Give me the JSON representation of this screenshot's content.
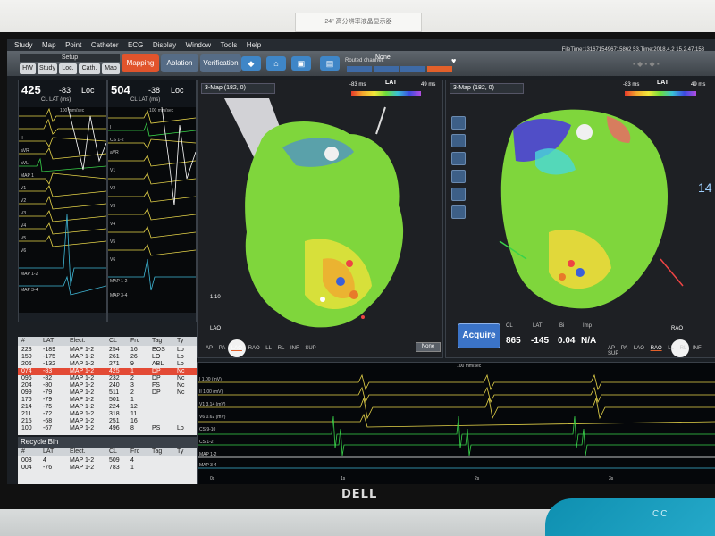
{
  "monitor_label": "24\" 高分辨率液晶显示器",
  "brand": "DELL",
  "cloth_text": "CC",
  "menu": [
    "Study",
    "Map",
    "Point",
    "Catheter",
    "ECG",
    "Display",
    "Window",
    "Tools",
    "Help"
  ],
  "file_time": "FileTime:1316715496715862 53.Time:2018.4.2 15.2.47.158",
  "toolbar": {
    "setup": "Setup",
    "tabs": [
      "HW",
      "Study",
      "Loc.",
      "Cath.",
      "Map"
    ],
    "modes": [
      "Mapping",
      "Ablation",
      "Verification"
    ],
    "routed_label": "Routed channel:",
    "routed_value": "None"
  },
  "ecg_panels": [
    {
      "cl": "425",
      "lat": "-83",
      "loc": "Loc",
      "sub": "CL  LAT (ms)",
      "speed": "100 mm/sec",
      "leads": [
        "I",
        "II",
        "aVR",
        "aVL",
        "MAP 1",
        "V1",
        "V2",
        "V3",
        "V4",
        "V5",
        "V6",
        "MAP 1-2",
        "MAP 3-4"
      ]
    },
    {
      "cl": "504",
      "lat": "-38",
      "loc": "Loc",
      "sub": "CL  LAT (ms)",
      "speed": "100 mm/sec",
      "leads": [
        "I",
        "CS 1-2",
        "aVR",
        "V1",
        "V2",
        "V3",
        "V4",
        "V5",
        "V6",
        "MAP 1-2",
        "MAP 3-4"
      ]
    }
  ],
  "maps": [
    {
      "selector": "3-Map (182, 0)",
      "cmin": "-83 ms",
      "clabel": "LAT",
      "cmax": "49 ms",
      "view": "LAO",
      "scale": "1.10",
      "none": "None"
    },
    {
      "selector": "3-Map (182, 0)",
      "cmin": "-83 ms",
      "clabel": "LAT",
      "cmax": "49 ms",
      "view": "RAO",
      "side_num": "14"
    }
  ],
  "view_tabs": [
    "AP",
    "PA",
    "LAO",
    "RAO",
    "LL",
    "RL",
    "INF",
    "SUP"
  ],
  "active_view_left": "LAO",
  "active_view_right": "RAO",
  "acquire": {
    "label": "Acquire",
    "cl_h": "CL",
    "cl_v": "865",
    "lat_h": "LAT",
    "lat_v": "-145",
    "bi_h": "Bi",
    "bi_v": "0.04",
    "imp_h": "Imp",
    "imp_v": "N/A"
  },
  "points_table": {
    "headers": [
      "#",
      "LAT",
      "Elect.",
      "CL",
      "Frc",
      "Tag",
      "Ty"
    ],
    "rows": [
      [
        "223",
        "-189",
        "MAP 1-2",
        "254",
        "16",
        "EOS",
        "Lo"
      ],
      [
        "150",
        "-175",
        "MAP 1-2",
        "261",
        "26",
        "LO",
        "Lo"
      ],
      [
        "206",
        "-132",
        "MAP 1-2",
        "271",
        "9",
        "ABL",
        "Lo"
      ],
      [
        "074",
        "-83",
        "MAP 1-2",
        "425",
        "1",
        "DP",
        "Nc"
      ],
      [
        "096",
        "-82",
        "MAP 1-2",
        "232",
        "2",
        "DP",
        "Nc"
      ],
      [
        "204",
        "-80",
        "MAP 1-2",
        "240",
        "3",
        "FS",
        "Nc"
      ],
      [
        "099",
        "-79",
        "MAP 1-2",
        "511",
        "2",
        "DP",
        "Nc"
      ],
      [
        "176",
        "-79",
        "MAP 1-2",
        "501",
        "1",
        "",
        ""
      ],
      [
        "214",
        "-75",
        "MAP 1-2",
        "224",
        "12",
        "",
        ""
      ],
      [
        "211",
        "-72",
        "MAP 1-2",
        "318",
        "11",
        "",
        ""
      ],
      [
        "215",
        "-68",
        "MAP 1-2",
        "251",
        "16",
        "",
        ""
      ],
      [
        "100",
        "-67",
        "MAP 1-2",
        "496",
        "8",
        "PS",
        "Lo"
      ]
    ],
    "highlight_index": 3
  },
  "recycle_bin": {
    "title": "Recycle Bin",
    "headers": [
      "#",
      "LAT",
      "Elect.",
      "CL",
      "Frc",
      "Tag",
      "Ty"
    ],
    "rows": [
      [
        "003",
        "4",
        "MAP 1-2",
        "509",
        "4",
        "",
        ""
      ],
      [
        "004",
        "-76",
        "MAP 1-2",
        "783",
        "1",
        "",
        ""
      ]
    ]
  },
  "signals": {
    "speed": "100 mm/sec",
    "channels": [
      "I 1.00 (mV)",
      "II 1.00 (mV)",
      "V1 3.14 (mV)",
      "V6 0.62 (mV)",
      "CS 9-10",
      "CS 1-2",
      "MAP 1-2",
      "MAP 3-4"
    ],
    "ticks": [
      "0s",
      "1s",
      "2s",
      "3s"
    ]
  },
  "colors": {
    "accent": "#e1542c",
    "ecg_yellow": "#e8d64a",
    "ecg_cyan": "#3fb7d6",
    "ecg_green": "#39d24a",
    "highlight_row": "#e34a35"
  }
}
